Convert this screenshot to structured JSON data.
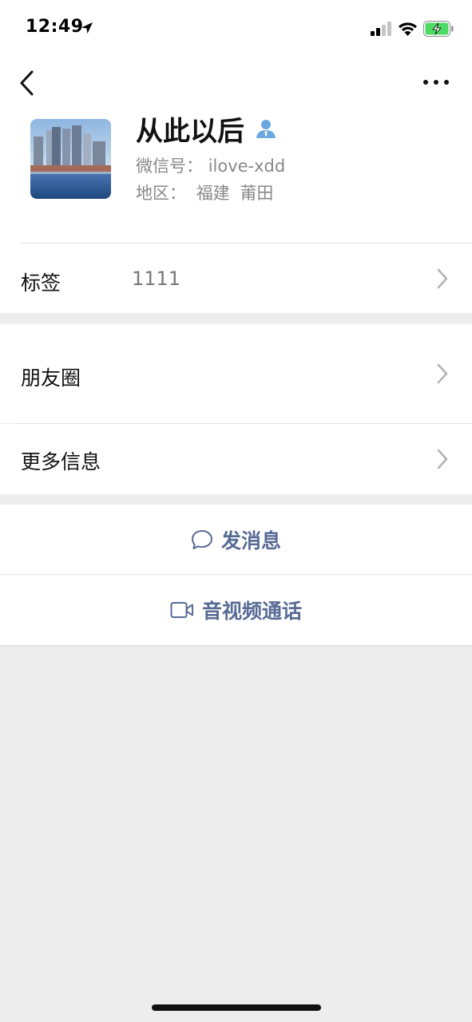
{
  "status_bar": {
    "time": "12:49"
  },
  "icons": {
    "back": "chevron-left-icon",
    "more": "ellipsis-icon",
    "location": "location-arrow-icon",
    "signal": "cellular-signal-icon",
    "wifi": "wifi-icon",
    "battery": "battery-charging-icon",
    "contact": "contact-person-icon",
    "chevron": "chevron-right-icon",
    "message": "chat-bubble-icon",
    "video": "video-camera-icon"
  },
  "profile": {
    "name": "从此以后",
    "wechat_id_label": "微信号：",
    "wechat_id": "ilove-xdd",
    "region_label": "地区：",
    "province": "福建",
    "city": "莆田"
  },
  "rows": {
    "tags_label": "标签",
    "tags_value": "1111",
    "moments_label": "朋友圈",
    "more_info_label": "更多信息"
  },
  "actions": {
    "send_message": "发消息",
    "video_call": "音视频通话"
  },
  "colors": {
    "link": "#576b95",
    "background": "#ededed",
    "battery_green": "#4cd964",
    "contact_blue": "#6aa7e0"
  }
}
